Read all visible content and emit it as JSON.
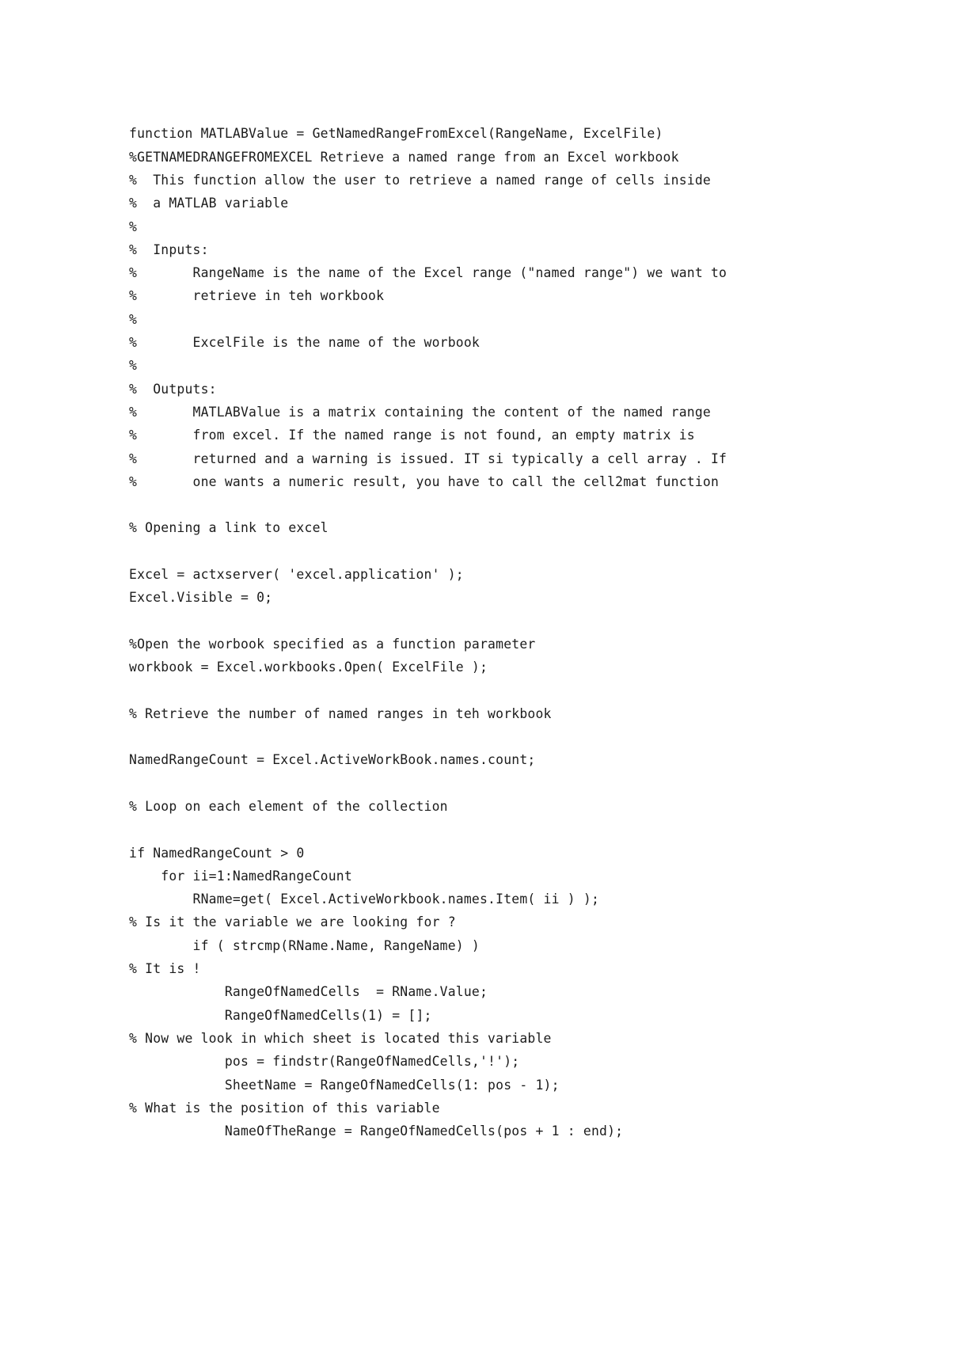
{
  "document": {
    "kind": "source-code-listing",
    "language": "MATLAB",
    "background_color": "#ffffff",
    "text_color": "#1c1c1c",
    "lines": [
      "function MATLABValue = GetNamedRangeFromExcel(RangeName, ExcelFile)",
      "%GETNAMEDRANGEFROMEXCEL Retrieve a named range from an Excel workbook",
      "%  This function allow the user to retrieve a named range of cells inside",
      "%  a MATLAB variable",
      "%",
      "%  Inputs:",
      "%       RangeName is the name of the Excel range (\"named range\") we want to",
      "%       retrieve in teh workbook",
      "%",
      "%       ExcelFile is the name of the worbook",
      "%",
      "%  Outputs:",
      "%       MATLABValue is a matrix containing the content of the named range",
      "%       from excel. If the named range is not found, an empty matrix is",
      "%       returned and a warning is issued. IT si typically a cell array . If",
      "%       one wants a numeric result, you have to call the cell2mat function",
      "",
      "% Opening a link to excel",
      "",
      "Excel = actxserver( 'excel.application' );",
      "Excel.Visible = 0;",
      "",
      "%Open the worbook specified as a function parameter",
      "workbook = Excel.workbooks.Open( ExcelFile );",
      "",
      "% Retrieve the number of named ranges in teh workbook",
      "",
      "NamedRangeCount = Excel.ActiveWorkBook.names.count;",
      "",
      "% Loop on each element of the collection",
      "",
      "if NamedRangeCount > 0",
      "    for ii=1:NamedRangeCount",
      "        RName=get( Excel.ActiveWorkbook.names.Item( ii ) );",
      "% Is it the variable we are looking for ?",
      "        if ( strcmp(RName.Name, RangeName) )",
      "% It is !",
      "            RangeOfNamedCells  = RName.Value;",
      "            RangeOfNamedCells(1) = [];",
      "% Now we look in which sheet is located this variable",
      "            pos = findstr(RangeOfNamedCells,'!');",
      "            SheetName = RangeOfNamedCells(1: pos - 1);",
      "% What is the position of this variable",
      "            NameOfTheRange = RangeOfNamedCells(pos + 1 : end);"
    ]
  }
}
